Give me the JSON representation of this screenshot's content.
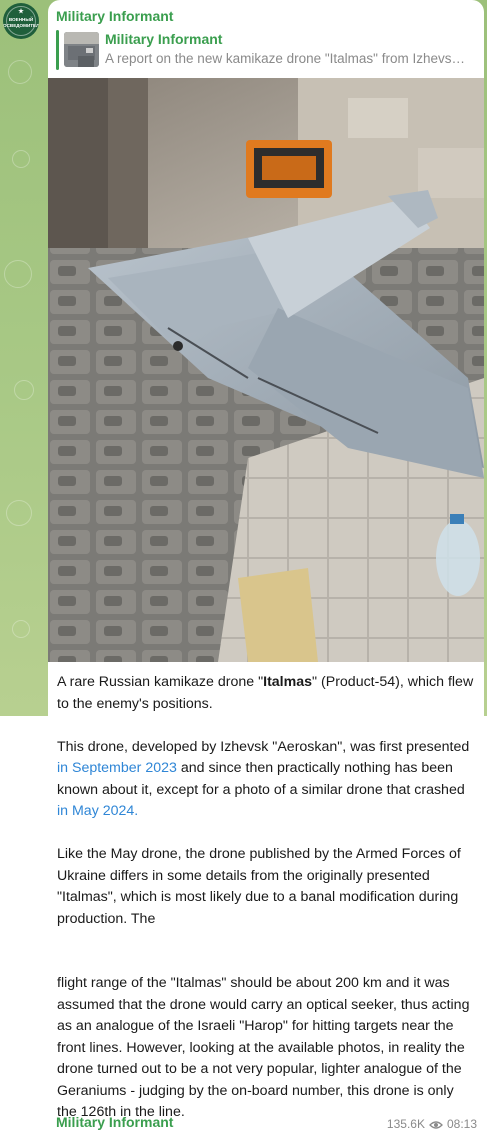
{
  "channel": {
    "avatar_text_line1": "ВОЕННЫЙ",
    "avatar_text_line2": "ОСВЕДОМИТЕЛЬ",
    "sender_name": "Military Informant"
  },
  "reply": {
    "name": "Military Informant",
    "text": "A report on the new kamikaze drone \"Italmas\" from Izhevs…"
  },
  "post": {
    "p1_a": "A rare Russian kamikaze drone \"",
    "p1_bold": "Italmas",
    "p1_b": "\" (Product-54), which flew to the enemy's positions.",
    "p2_a": "This drone, developed by Izhevsk \"Aeroskan\", was first presented ",
    "p2_link1": "in September 2023",
    "p2_b": " and since then practically nothing has been known about it, except for a photo of a similar drone that crashed ",
    "p2_link2": "in May 2024.",
    "p3": "Like the May drone, the drone published by the Armed Forces of Ukraine differs in some details from the originally presented \"Italmas\", which is most likely due to a banal modification during production. The",
    "p4": "flight range of the \"Italmas\" should be about 200 km and it was assumed that the drone would carry an optical seeker, thus acting as an analogue of the Israeli \"Harop\" for hitting targets near the front lines. However, looking at the available photos, in reality the drone turned out to be a not very popular, lighter analogue of the Geraniums - judging by the on-board number, this drone is only the 126th in the line."
  },
  "footer": {
    "sender_name": "Military Informant",
    "views": "135.6K",
    "time": "08:13",
    "views_icon": "eye-icon"
  },
  "colors": {
    "accent_green": "#3a9e4e",
    "link_blue": "#2f86d6",
    "chat_background": "#a9c986"
  }
}
